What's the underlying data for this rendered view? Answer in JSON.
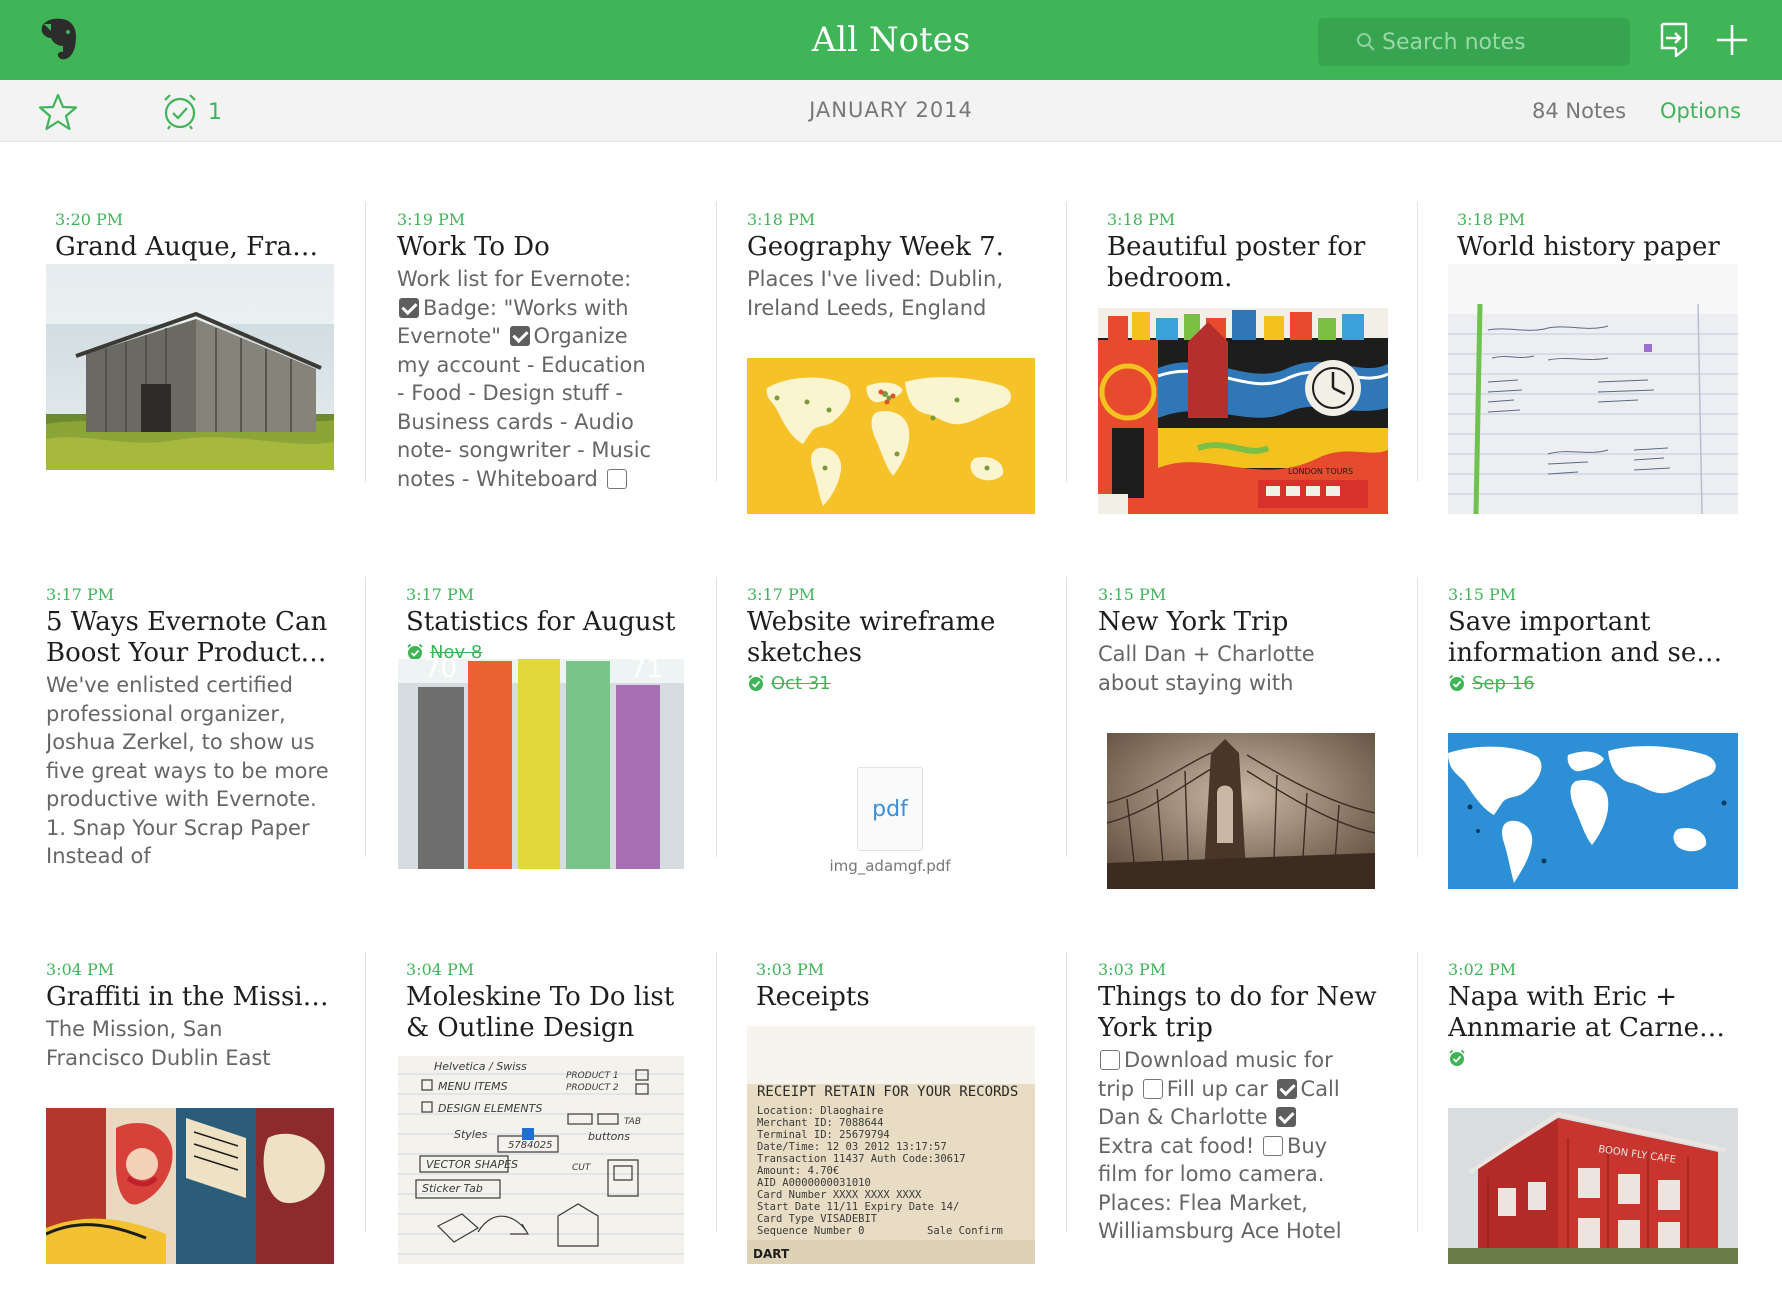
{
  "header": {
    "title": "All Notes",
    "search_placeholder": "Search notes"
  },
  "toolbar": {
    "reminder_count": "1",
    "month": "JANUARY 2014",
    "note_count": "84 Notes",
    "options_label": "Options"
  },
  "icons": {
    "logo": "evernote-elephant-icon",
    "search": "search-icon",
    "present": "presentation-icon",
    "new_note": "plus-icon",
    "shortcuts": "star-icon",
    "reminders": "alarm-clock-icon"
  },
  "colors": {
    "accent": "#3fb558",
    "header": "#3fb558"
  },
  "notes": [
    {
      "time": "3:20 PM",
      "title": "Grand Auque, Fran…"
    },
    {
      "time": "3:19 PM",
      "title": "Work To Do",
      "body": {
        "l1": "Work list for Evernote:",
        "l2": "Badge: \"Works with",
        "l3a": "Evernote\"",
        "l3b": "Organize",
        "l4": "my account - Education",
        "l5": "- Food - Design stuff -",
        "l6": "Business cards - Audio",
        "l7": "note- songwriter - Music",
        "l8": "notes - Whiteboard"
      }
    },
    {
      "time": "3:18 PM",
      "title": "Geography Week 7.",
      "body": "Places I've lived: Dublin, Ireland Leeds, England"
    },
    {
      "time": "3:18 PM",
      "title": "Beautiful poster for bedroom."
    },
    {
      "time": "3:18 PM",
      "title": "World history paper"
    },
    {
      "time": "3:17 PM",
      "title": "5 Ways Evernote Can Boost Your Product…",
      "body": "We've enlisted certified professional organizer, Joshua Zerkel, to show us five great ways to be more productive with Evernote. 1. Snap Your Scrap Paper Instead of"
    },
    {
      "time": "3:17 PM",
      "title": "Statistics for August",
      "reminder": "Nov 8",
      "chart_labels": {
        "left": "70",
        "right": "71"
      }
    },
    {
      "time": "3:17 PM",
      "title": "Website wireframe sketches",
      "reminder": "Oct 31",
      "attachment_type": "pdf",
      "attachment_name": "img_adamgf.pdf"
    },
    {
      "time": "3:15 PM",
      "title": "New York Trip",
      "body": "Call Dan + Charlotte about staying with"
    },
    {
      "time": "3:15 PM",
      "title": "Save important information and se…",
      "reminder": "Sep 16"
    },
    {
      "time": "3:04 PM",
      "title": "Graffiti in the Missi…",
      "body": "The Mission, San Francisco Dublin East"
    },
    {
      "time": "3:04 PM",
      "title": "Moleskine To Do list & Outline Design I…",
      "sketch": {
        "l1": "Helvetica / Swiss",
        "l2": "MENU ITEMS",
        "l3": "DESIGN ELEMENTS",
        "l4": "Styles",
        "l5": "VECTOR SHAPES",
        "l6": "Sticker Tab",
        "r1": "PRODUCT 1",
        "r2": "PRODUCT 2",
        "r3": "TAB",
        "r4": "buttons",
        "r5": "CUT",
        "n1": "5784025"
      }
    },
    {
      "time": "3:03 PM",
      "title": "Receipts",
      "receipt": {
        "head": "RECEIPT RETAIN FOR YOUR RECORDS",
        "l1": "Location: Dlaoghaire",
        "l2": "Merchant ID: 7088644",
        "l3": "Terminal ID: 25679794",
        "l4": "Date/Time: 12 03 2012 13:17:57",
        "l5": "Transaction 11437 Auth Code:30617",
        "l6": "Amount: 4.70€",
        "l7": "AID A0000000031010",
        "l8": "Card Number XXXX XXXX XXXX",
        "l9": "Start Date 11/11 Expiry Date 14/",
        "l10": "Card Type VISADEBIT",
        "l11": "Sequence Number 0",
        "l12": "Sale Confirm",
        "foot": "DART"
      }
    },
    {
      "time": "3:03 PM",
      "title": "Things to do for New York trip",
      "body": {
        "t1": "Download music for",
        "t2": "trip",
        "t3": "Fill up car",
        "t4": "Call",
        "t5": "Dan & Charlotte",
        "t6": "Extra cat food!",
        "t7": "Buy",
        "t8": "film for lomo camera.",
        "t9": "Places: Flea Market,",
        "t10": "Williamsburg Ace Hotel"
      }
    },
    {
      "time": "3:02 PM",
      "title": "Napa with Eric + Annmarie at Carne…",
      "sign": "BOON FLY CAFE"
    }
  ],
  "poster_label": "LONDON TOURS"
}
